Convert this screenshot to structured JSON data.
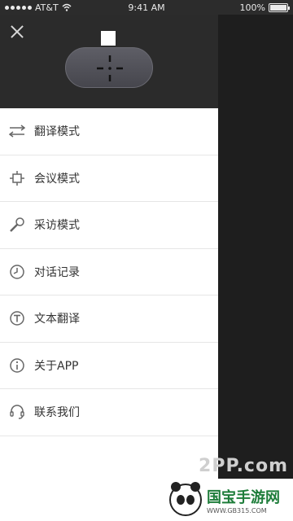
{
  "status_bar": {
    "carrier": "AT&T",
    "time": "9:41 AM",
    "battery": "100%",
    "battery_level": 1.0
  },
  "header": {
    "close_icon": "close-icon",
    "device_icon": "device-icon"
  },
  "menu": {
    "items": [
      {
        "label": "翻译模式",
        "icon": "sliders-icon"
      },
      {
        "label": "会议模式",
        "icon": "meeting-icon"
      },
      {
        "label": "采访模式",
        "icon": "microphone-icon"
      },
      {
        "label": "对话记录",
        "icon": "clock-icon"
      },
      {
        "label": "文本翻译",
        "icon": "text-icon"
      },
      {
        "label": "关于APP",
        "icon": "info-icon"
      },
      {
        "label": "联系我们",
        "icon": "headset-icon"
      }
    ]
  },
  "watermark": {
    "top": "2PP.com",
    "title": "国宝手游网",
    "url": "WWW.GB315.COM"
  }
}
